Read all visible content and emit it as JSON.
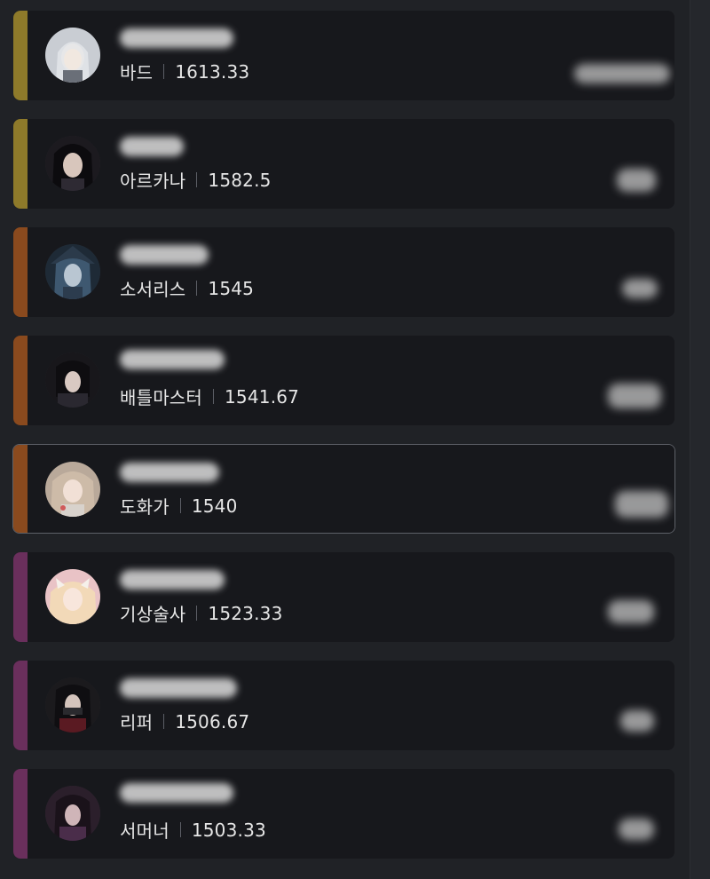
{
  "colors": {
    "background": "#202226",
    "card": "#17181c",
    "text": "#e6e6e6",
    "separator": "#5c5f66",
    "selected_border": "#5e6168"
  },
  "ranking": {
    "items": [
      {
        "class_name": "바드",
        "score": "1613.33",
        "accent_color": "#8e7a2a",
        "avatar_icon": "bard-portrait-icon",
        "selected": false
      },
      {
        "class_name": "아르카나",
        "score": "1582.5",
        "accent_color": "#8e7a2a",
        "avatar_icon": "arcana-portrait-icon",
        "selected": false
      },
      {
        "class_name": "소서리스",
        "score": "1545",
        "accent_color": "#8a4a1e",
        "avatar_icon": "sorceress-portrait-icon",
        "selected": false
      },
      {
        "class_name": "배틀마스터",
        "score": "1541.67",
        "accent_color": "#8a4a1e",
        "avatar_icon": "battlemaster-portrait-icon",
        "selected": false
      },
      {
        "class_name": "도화가",
        "score": "1540",
        "accent_color": "#8a4a1e",
        "avatar_icon": "artist-portrait-icon",
        "selected": true
      },
      {
        "class_name": "기상술사",
        "score": "1523.33",
        "accent_color": "#6a2f5c",
        "avatar_icon": "aeromancer-portrait-icon",
        "selected": false
      },
      {
        "class_name": "리퍼",
        "score": "1506.67",
        "accent_color": "#6a2f5c",
        "avatar_icon": "reaper-portrait-icon",
        "selected": false
      },
      {
        "class_name": "서머너",
        "score": "1503.33",
        "accent_color": "#6a2f5c",
        "avatar_icon": "summoner-portrait-icon",
        "selected": false
      }
    ]
  }
}
